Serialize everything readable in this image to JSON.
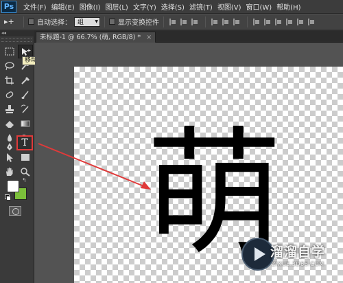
{
  "app": {
    "logo": "Ps"
  },
  "menu": {
    "items": [
      "文件(F)",
      "编辑(E)",
      "图像(I)",
      "图层(L)",
      "文字(Y)",
      "选择(S)",
      "滤镜(T)",
      "视图(V)",
      "窗口(W)",
      "帮助(H)"
    ]
  },
  "options": {
    "tool_glyph": "▸+",
    "auto_select_label": "自动选择：",
    "auto_select_value": "组",
    "transform_label": "显示变换控件"
  },
  "panel_collapse": "◂◂",
  "document": {
    "tab_title": "未标题-1 @ 66.7% (萌, RGB/8) *",
    "close_glyph": "×",
    "content_char": "萌"
  },
  "toolbox": {
    "tooltip": "移动工具 (V)",
    "type_tool_glyph": "T",
    "foreground_color": "#ffffff",
    "background_color": "#7bbf3a"
  },
  "watermark": {
    "title": "溜溜自学",
    "url": "ZIXUE.3D66.COM"
  },
  "colors": {
    "annotation_red": "#e03a3a"
  }
}
